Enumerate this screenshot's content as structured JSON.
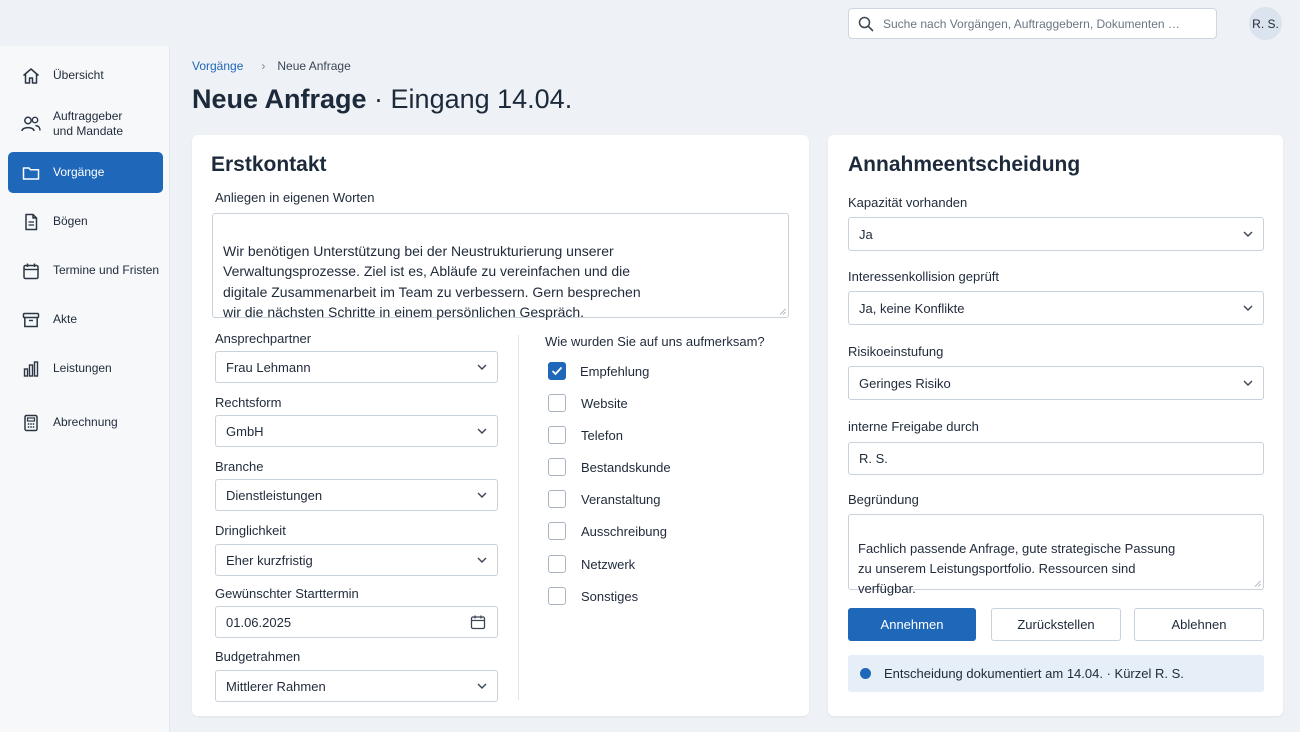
{
  "search": {
    "placeholder": "Suche nach Vorgängen, Auftraggebern, Dokumenten …"
  },
  "user": {
    "initials": "R. S."
  },
  "sidebar": {
    "items": [
      {
        "label": "Übersicht",
        "icon": "home-icon"
      },
      {
        "label": "Auftraggeber\nund Mandate",
        "icon": "users-icon"
      },
      {
        "label": "Vorgänge",
        "icon": "folder-icon",
        "active": true
      },
      {
        "label": "Bögen",
        "icon": "document-icon"
      },
      {
        "label": "Termine und Fristen",
        "icon": "calendar-icon"
      },
      {
        "label": "Akte",
        "icon": "archive-icon"
      },
      {
        "label": "Leistungen",
        "icon": "bar-chart-icon"
      },
      {
        "label": "Abrechnung",
        "icon": "calculator-icon"
      }
    ]
  },
  "breadcrumb": {
    "parent": "Vorgänge",
    "separator": "›",
    "current": "Neue Anfrage"
  },
  "page": {
    "title": "Neue Anfrage",
    "subtitle": " · Eingang 14.04."
  },
  "erstkontakt": {
    "title": "Erstkontakt",
    "anliegen_label": "Anliegen in eigenen Worten",
    "anliegen_text": "Wir benötigen Unterstützung bei der Neustrukturierung unserer\nVerwaltungsprozesse. Ziel ist es, Abläufe zu vereinfachen und die\ndigitale Zusammenarbeit im Team zu verbessern. Gern besprechen\nwir die nächsten Schritte in einem persönlichen Gespräch.",
    "fields": [
      {
        "label": "Ansprechpartner",
        "value": "Frau Lehmann",
        "kind": "select"
      },
      {
        "label": "Rechtsform",
        "value": "GmbH",
        "kind": "select"
      },
      {
        "label": "Branche",
        "value": "Dienstleistungen",
        "kind": "select"
      },
      {
        "label": "Dringlichkeit",
        "value": "Eher kurzfristig",
        "kind": "select"
      },
      {
        "label": "Gewünschter Starttermin",
        "value": "01.06.2025",
        "kind": "date"
      },
      {
        "label": "Budgetrahmen",
        "value": "Mittlerer Rahmen",
        "kind": "select"
      }
    ],
    "source_question": "Wie wurden Sie auf uns aufmerksam?",
    "sources": [
      {
        "label": "Empfehlung",
        "checked": true
      },
      {
        "label": "Website",
        "checked": false
      },
      {
        "label": "Telefon",
        "checked": false
      },
      {
        "label": "Bestandskunde",
        "checked": false
      },
      {
        "label": "Veranstaltung",
        "checked": false
      },
      {
        "label": "Ausschreibung",
        "checked": false
      },
      {
        "label": "Netzwerk",
        "checked": false
      },
      {
        "label": "Sonstiges",
        "checked": false
      }
    ]
  },
  "annahme": {
    "title": "Annahmeentscheidung",
    "kapazitaet": {
      "label": "Kapazität vorhanden",
      "value": "Ja"
    },
    "interessenkollision": {
      "label": "Interessenkollision geprüft",
      "value": "Ja, keine Konflikte"
    },
    "risiko": {
      "label": "Risikoeinstufung",
      "value": "Geringes Risiko"
    },
    "freigabe": {
      "label": "interne Freigabe durch",
      "value": "R. S."
    },
    "begruendung": {
      "label": "Begründung",
      "value": "Fachlich passende Anfrage, gute strategische Passung\nzu unserem Leistungsportfolio. Ressourcen sind\nverfügbar."
    },
    "buttons": {
      "accept": "Annehmen",
      "defer": "Zurückstellen",
      "reject": "Ablehnen"
    },
    "status": "Entscheidung dokumentiert am 14.04. · Kürzel R. S."
  },
  "colors": {
    "accent": "#1e67b9",
    "status_bg": "#e6eef7"
  }
}
